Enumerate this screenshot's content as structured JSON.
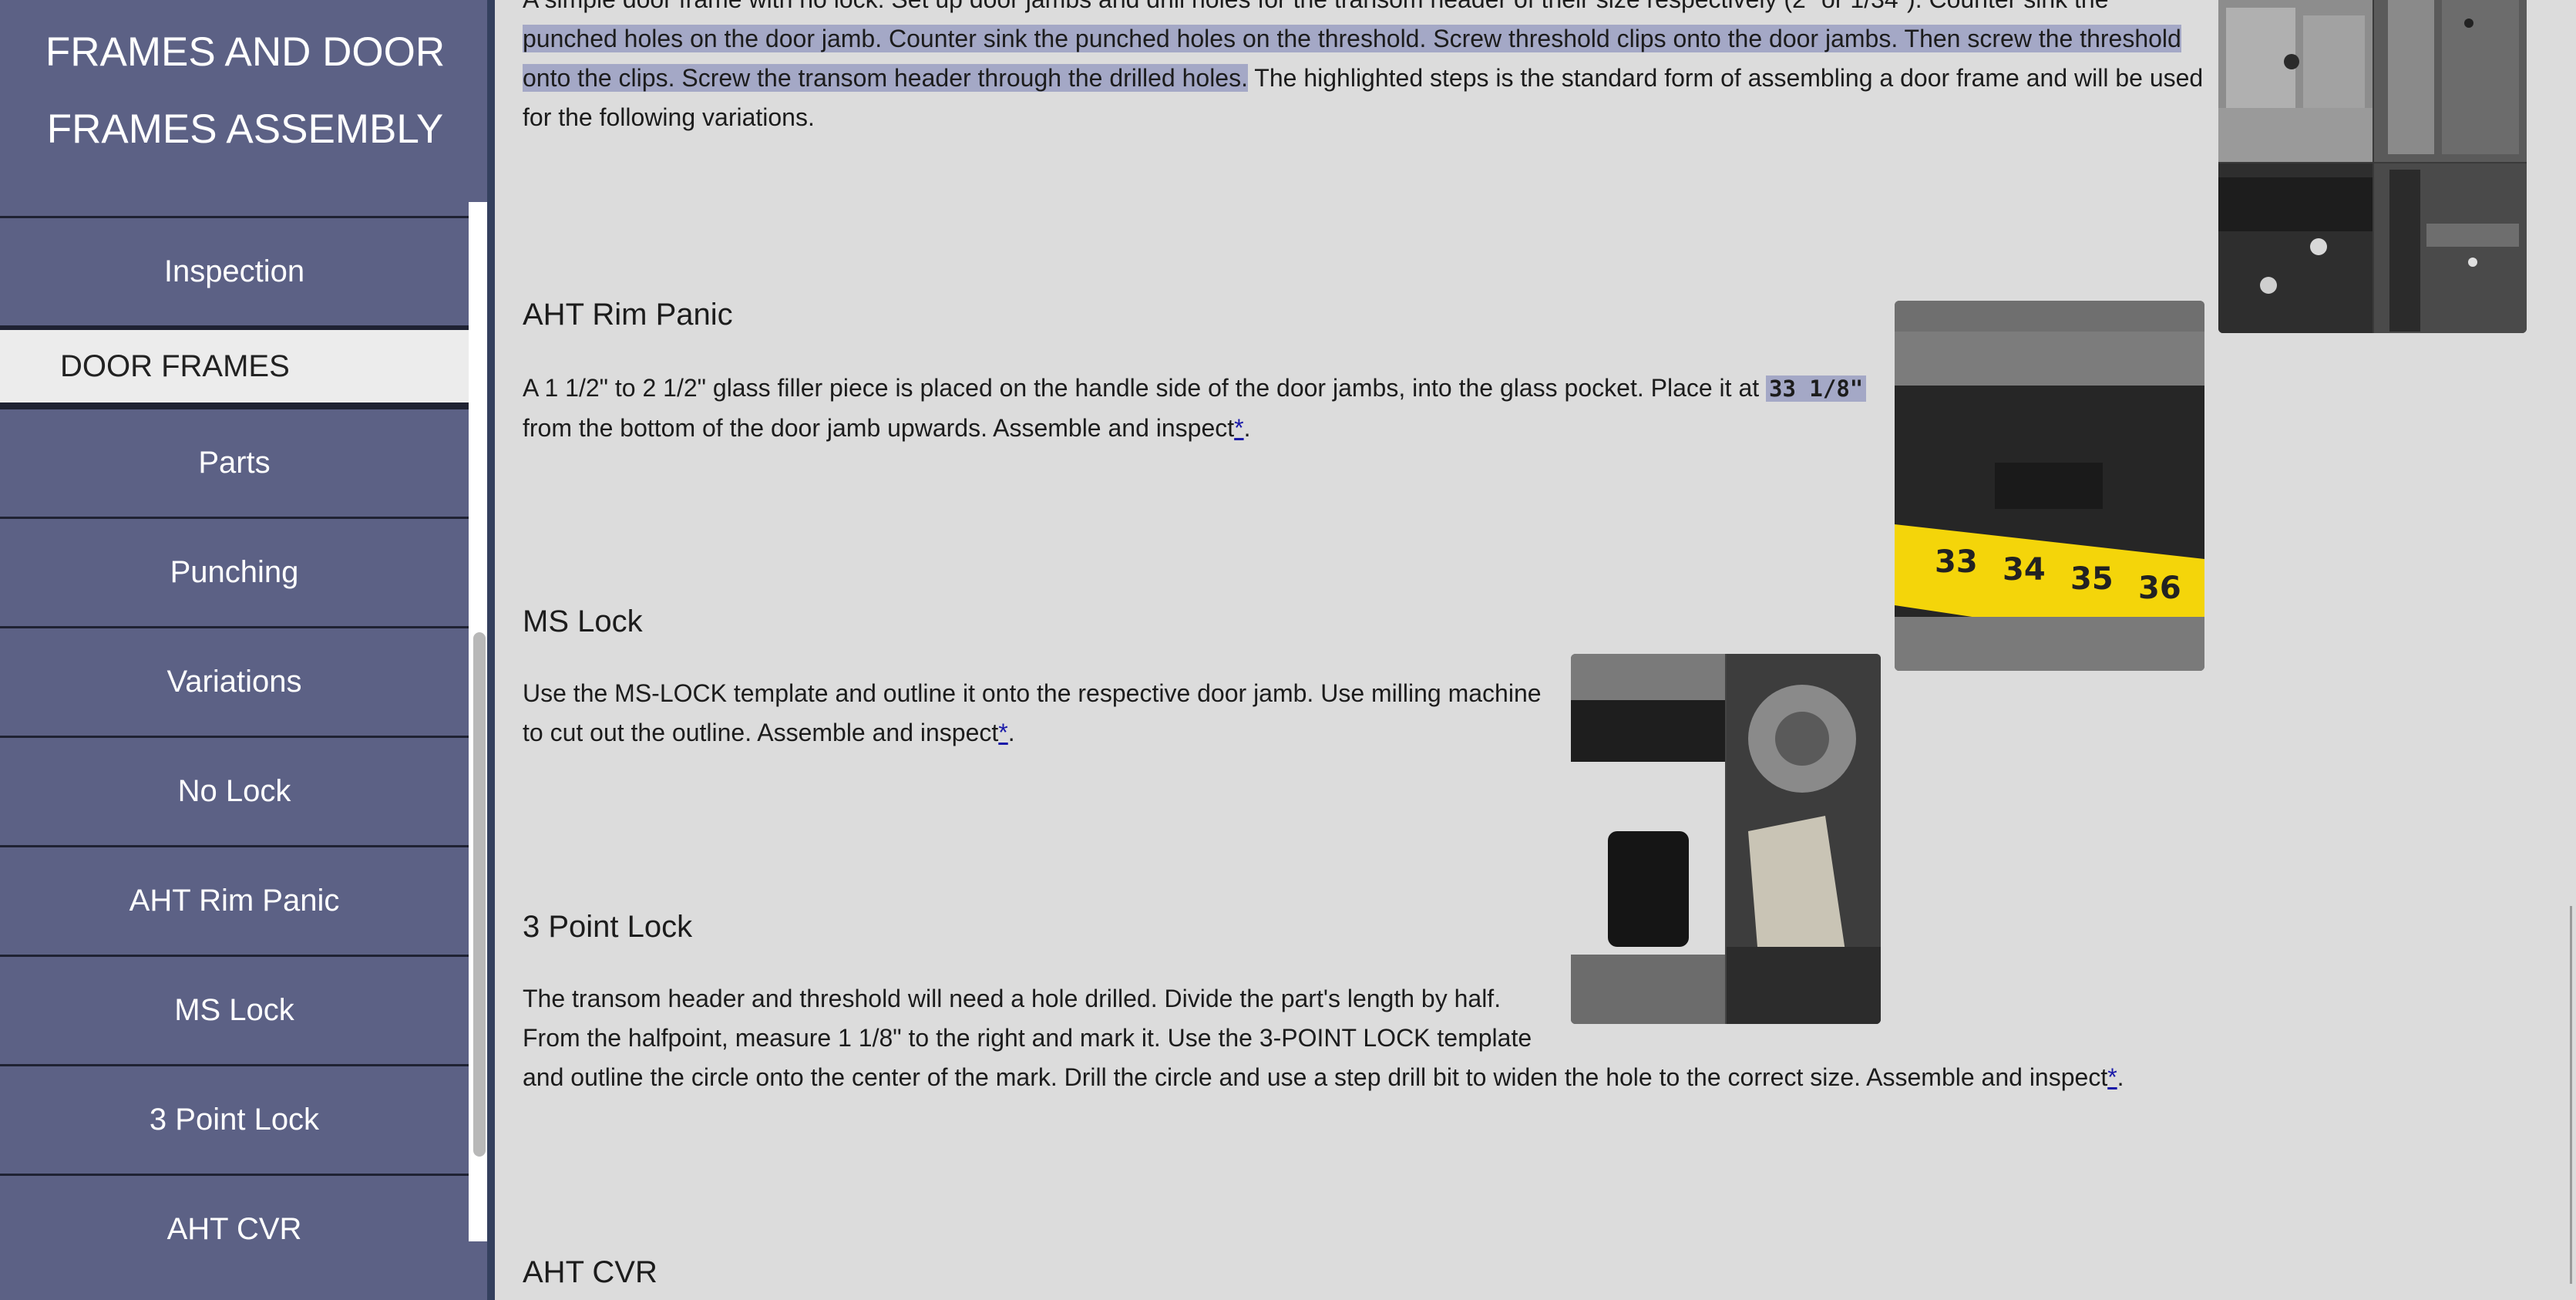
{
  "sidebar": {
    "title_line1": "FRAMES AND DOOR",
    "title_line2": "FRAMES ASSEMBLY",
    "items": [
      {
        "label": "Inspection"
      },
      {
        "label": "DOOR FRAMES"
      },
      {
        "label": "Parts"
      },
      {
        "label": "Punching"
      },
      {
        "label": "Variations"
      },
      {
        "label": "No Lock"
      },
      {
        "label": "AHT Rim Panic"
      },
      {
        "label": "MS Lock"
      },
      {
        "label": "3 Point Lock"
      },
      {
        "label": "AHT CVR"
      }
    ]
  },
  "content": {
    "intro": {
      "line0": "A simple door frame with no lock. Set up door jambs and drill holes for the transom header of their size respectively (2\" or 1/34\"). Counter sink the",
      "hl_a": "punched holes on the door jamb. Counter sink the punched holes on the threshold. Screw threshold clips onto the door jambs. Then screw the threshold",
      "hl_b": "onto the clips. Screw the transom header through the drilled holes.",
      "tail": " The highlighted steps is the standard form of assembling a door frame and will be used",
      "line3": "for the following variations."
    },
    "rim_panic": {
      "heading": "AHT Rim Panic",
      "text_a": "A 1 1/2\" to 2 1/2\" glass filler piece is placed on the handle side of the door jambs, into the glass pocket. Place it at ",
      "code": "33 1/8\"",
      "text_b": "from the bottom of the door jamb upwards. Assemble and inspect",
      "link": "*",
      "end": "."
    },
    "ms_lock": {
      "heading": "MS Lock",
      "line1": "Use the MS-LOCK template and outline it onto the respective door jamb. Use milling machine",
      "line2": "to cut out the outline. Assemble and inspect",
      "link": "*",
      "end": "."
    },
    "three_point": {
      "heading": "3 Point Lock",
      "line1": "The transom header and threshold will need a hole drilled. Divide the part's length by half.",
      "line2": "From the halfpoint, measure 1 1/8\" to the right and mark it. Use the 3-POINT LOCK template",
      "line3": "and outline the circle onto the center of the mark. Drill the circle and use a step drill bit to widen the hole to the correct size. Assemble and inspect",
      "link": "*",
      "end": "."
    },
    "cvr": {
      "heading": "AHT CVR"
    },
    "tape_numbers": [
      "33",
      "34",
      "35",
      "36"
    ]
  }
}
